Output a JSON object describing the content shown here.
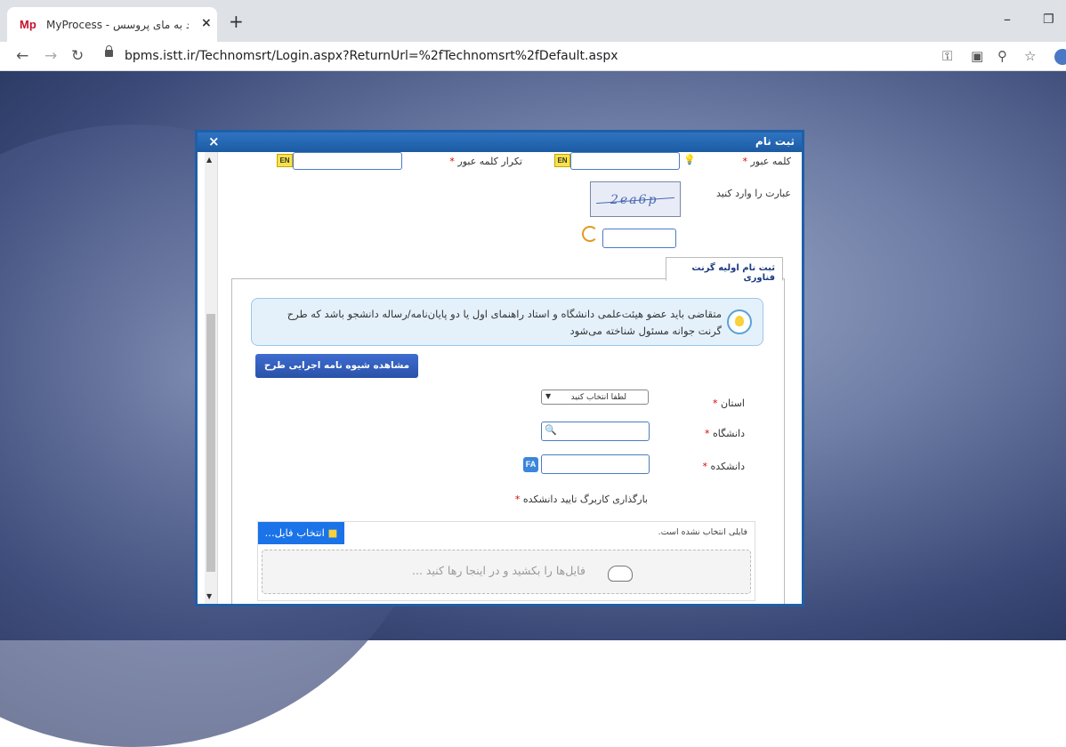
{
  "browser": {
    "tab_logo": "Mp",
    "tab_title": "MyProcess - ورود به مای پروسس",
    "new_tab": "+",
    "url": "bpms.istt.ir/Technomsrt/Login.aspx?ReturnUrl=%2fTechnomsrt%2fDefault.aspx"
  },
  "dialog": {
    "title": "ثبت نام",
    "close": "×",
    "password_label": "کلمه عبور",
    "password_repeat_label": "تکرار کلمه عبور",
    "required_mark": "*",
    "en_badge": "EN",
    "captcha_label": "عبارت را وارد کنید",
    "captcha_text": "2ea6p",
    "tab_label": "ثبت نام اولیه گرنت فناوری",
    "info_text": "متقاضی باید عضو هیئت‌علمی دانشگاه و استاد راهنمای اول یا دو پایان‌نامه/رساله دانشجو باشد که طرح گرنت جوانه مسئول شناخته می‌شود",
    "view_button": "مشاهده شیوه نامه اجرایی طرح جوانه",
    "province_label": "استان",
    "province_value": "لطفا انتخاب کنید",
    "university_label": "دانشگاه",
    "faculty_label": "دانشکده",
    "fa_badge": "FA",
    "upload_label": "بارگذاری کاربرگ تایید دانشکده",
    "choose_file": "انتخاب فایل...",
    "no_file": "فایلی انتخاب نشده است.",
    "drop_text": "فایل‌ها را بکشید و در اینجا رها کنید ..."
  }
}
